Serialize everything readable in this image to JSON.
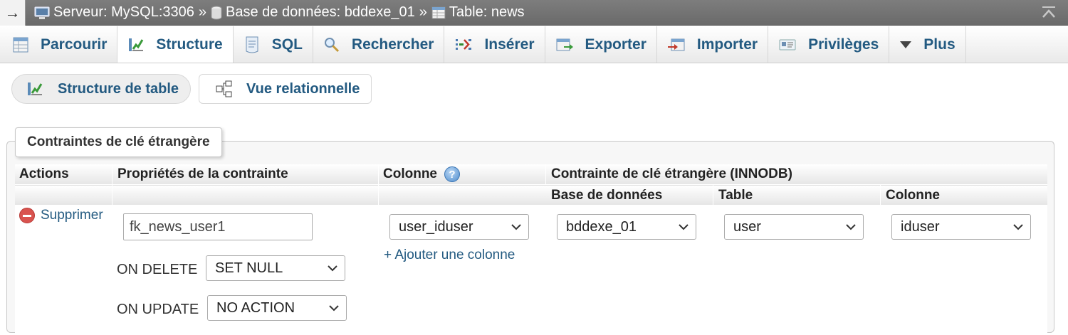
{
  "breadcrumb": {
    "collapse_glyph": "→",
    "server": "Serveur: MySQL:3306",
    "database": "Base de données: bddexe_01",
    "table": "Table: news",
    "separator": "»"
  },
  "tabs": [
    {
      "label": "Parcourir",
      "icon": "browse-icon"
    },
    {
      "label": "Structure",
      "icon": "structure-icon",
      "active": true
    },
    {
      "label": "SQL",
      "icon": "sql-icon"
    },
    {
      "label": "Rechercher",
      "icon": "search-icon"
    },
    {
      "label": "Insérer",
      "icon": "insert-icon"
    },
    {
      "label": "Exporter",
      "icon": "export-icon"
    },
    {
      "label": "Importer",
      "icon": "import-icon"
    },
    {
      "label": "Privilèges",
      "icon": "privileges-icon"
    },
    {
      "label": "Plus",
      "icon": "caret-down-icon"
    }
  ],
  "subtabs": {
    "table_structure": "Structure de table",
    "relation_view": "Vue relationnelle"
  },
  "fieldset": {
    "legend": "Contraintes de clé étrangère"
  },
  "table": {
    "headers": {
      "actions": "Actions",
      "constraint_props": "Propriétés de la contrainte",
      "column": "Colonne",
      "fk_constraint": "Contrainte de clé étrangère (INNODB)",
      "database": "Base de données",
      "table": "Table",
      "fk_column": "Colonne"
    },
    "row": {
      "delete_label": "Supprimer",
      "constraint_name": "fk_news_user1",
      "on_delete_label": "ON DELETE",
      "on_delete_value": "SET NULL",
      "on_update_label": "ON UPDATE",
      "on_update_value": "NO ACTION",
      "column_value": "user_iduser",
      "add_column": "+ Ajouter une colonne",
      "database_value": "bddexe_01",
      "table_value": "user",
      "fk_column_value": "iduser"
    }
  },
  "colors": {
    "link": "#235a81",
    "topbar": "#737373",
    "delete": "#d9534f"
  }
}
